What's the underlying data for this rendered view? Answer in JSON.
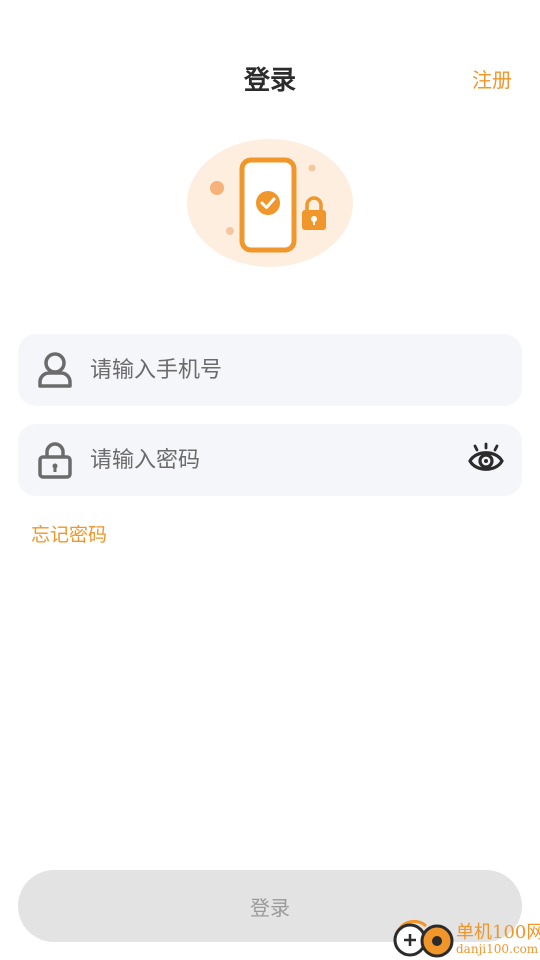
{
  "header": {
    "title": "登录",
    "register_label": "注册"
  },
  "illustration": {
    "icon": "phone-lock-illustration"
  },
  "phone_field": {
    "icon": "user-icon",
    "placeholder": "请输入手机号",
    "value": ""
  },
  "password_field": {
    "icon": "lock-icon",
    "placeholder": "请输入密码",
    "value": "",
    "toggle_icon": "eye-icon"
  },
  "forgot_password_label": "忘记密码",
  "login_button_label": "登录",
  "watermark": {
    "name": "单机100网",
    "url": "danji100.com"
  },
  "colors": {
    "accent": "#f0962a",
    "field_bg": "#f5f6fa",
    "button_disabled_bg": "#e3e3e3",
    "button_disabled_text": "#9a9a9a"
  }
}
